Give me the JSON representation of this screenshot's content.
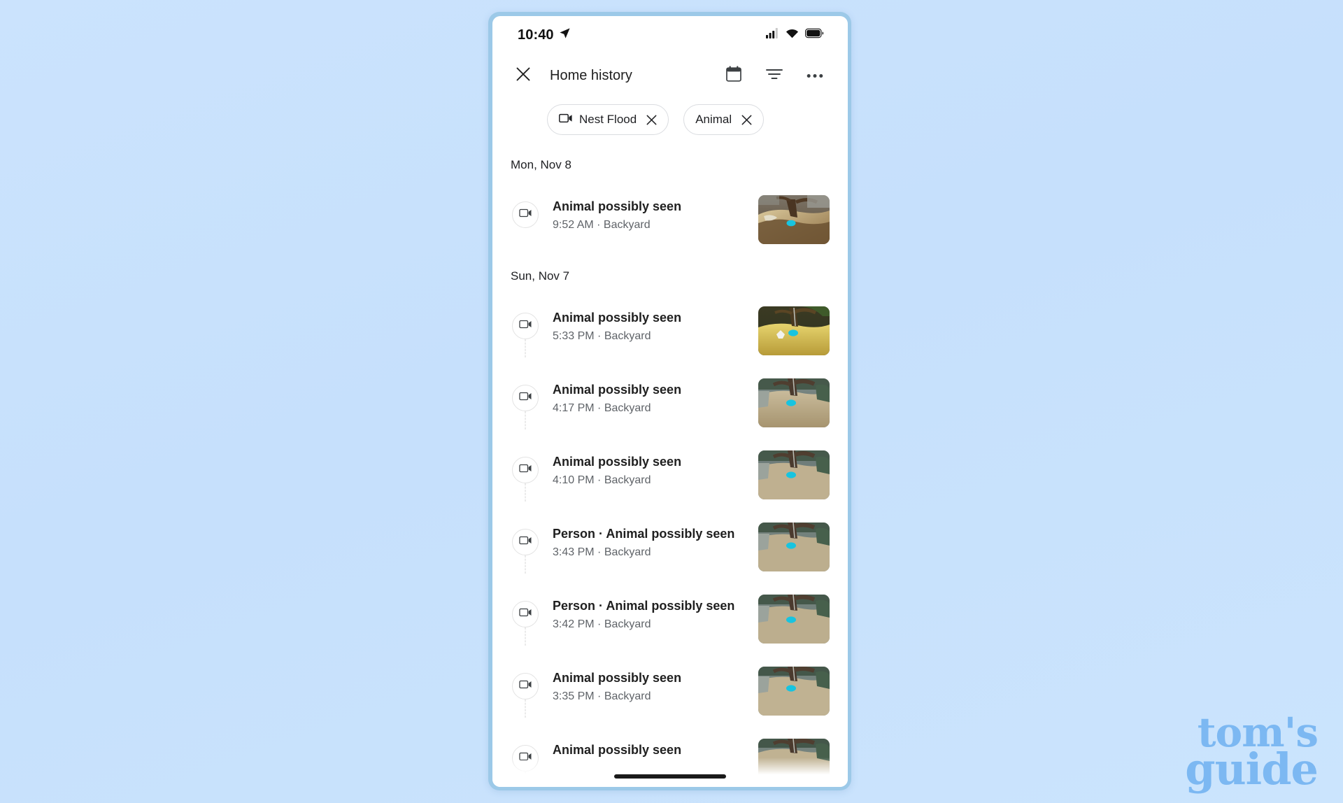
{
  "background": {
    "color_top": "#cbe3fd",
    "color_bottom": "#c6e0fc"
  },
  "phone": {
    "frame_color": "#9cc9e8",
    "status_bar": {
      "time": "10:40",
      "location_icon": "location-arrow-icon",
      "signal_icon": "cellular-signal-icon",
      "wifi_icon": "wifi-icon",
      "battery_icon": "battery-full-icon"
    },
    "app_bar": {
      "close_icon": "close-icon",
      "title": "Home history",
      "calendar_icon": "calendar-icon",
      "filter_icon": "filter-icon",
      "overflow_icon": "more-options-icon"
    },
    "home_indicator": true
  },
  "chips": [
    {
      "label": "Nest Flood",
      "icon": "video-camera-icon",
      "has_remove": true,
      "remove_icon": "close-icon"
    },
    {
      "label": "Animal",
      "icon": null,
      "has_remove": true,
      "remove_icon": "close-icon"
    }
  ],
  "sections": [
    {
      "date": "Mon, Nov 8",
      "events": [
        {
          "title": "Animal possibly seen",
          "time": "9:52 AM",
          "separator": " · ",
          "location": "Backyard",
          "icon": "video-camera-icon",
          "thumbnail": "sunny-tree-mulch-bed",
          "thumb_palette": [
            "#8a6f57",
            "#b08a52",
            "#d8c191",
            "#6a5438"
          ],
          "has_connector": false
        }
      ]
    },
    {
      "date": "Sun, Nov 7",
      "events": [
        {
          "title": "Animal possibly seen",
          "time": "5:33 PM",
          "separator": " · ",
          "location": "Backyard",
          "icon": "video-camera-icon",
          "thumbnail": "golden-hour-leaves",
          "thumb_palette": [
            "#4d4a2c",
            "#c9b24a",
            "#e0cf71",
            "#2f3a22"
          ],
          "has_connector": true
        },
        {
          "title": "Animal possibly seen",
          "time": "4:17 PM",
          "separator": " · ",
          "location": "Backyard",
          "icon": "video-camera-icon",
          "thumbnail": "overcast-tree-gravel",
          "thumb_palette": [
            "#6f7d7a",
            "#b6a98c",
            "#cdbfa0",
            "#3d4a44"
          ],
          "has_connector": true
        },
        {
          "title": "Animal possibly seen",
          "time": "4:10 PM",
          "separator": " · ",
          "location": "Backyard",
          "icon": "video-camera-icon",
          "thumbnail": "overcast-tree-gravel",
          "thumb_palette": [
            "#6f7d7a",
            "#b6a98c",
            "#cdbfa0",
            "#3d4a44"
          ],
          "has_connector": true
        },
        {
          "title": "Person · Animal possibly seen",
          "time": "3:43 PM",
          "separator": " · ",
          "location": "Backyard",
          "icon": "video-camera-icon",
          "thumbnail": "overcast-tree-gravel",
          "thumb_palette": [
            "#6f7d7a",
            "#b6a98c",
            "#cdbfa0",
            "#3d4a44"
          ],
          "has_connector": true
        },
        {
          "title": "Person · Animal possibly seen",
          "time": "3:42 PM",
          "separator": " · ",
          "location": "Backyard",
          "icon": "video-camera-icon",
          "thumbnail": "overcast-tree-gravel",
          "thumb_palette": [
            "#6f7d7a",
            "#b6a98c",
            "#cdbfa0",
            "#3d4a44"
          ],
          "has_connector": true
        },
        {
          "title": "Animal possibly seen",
          "time": "3:35 PM",
          "separator": " · ",
          "location": "Backyard",
          "icon": "video-camera-icon",
          "thumbnail": "overcast-tree-gravel",
          "thumb_palette": [
            "#6f7d7a",
            "#b6a98c",
            "#cdbfa0",
            "#3d4a44"
          ],
          "has_connector": true
        },
        {
          "title": "Animal possibly seen",
          "time": "",
          "separator": "",
          "location": "",
          "icon": "video-camera-icon",
          "thumbnail": "overcast-tree-gravel",
          "thumb_palette": [
            "#6f7d7a",
            "#b6a98c",
            "#cdbfa0",
            "#3d4a44"
          ],
          "has_connector": true
        }
      ]
    }
  ],
  "watermark": {
    "line1": "tom's",
    "line2": "guide",
    "color": "#7cb8f2"
  }
}
